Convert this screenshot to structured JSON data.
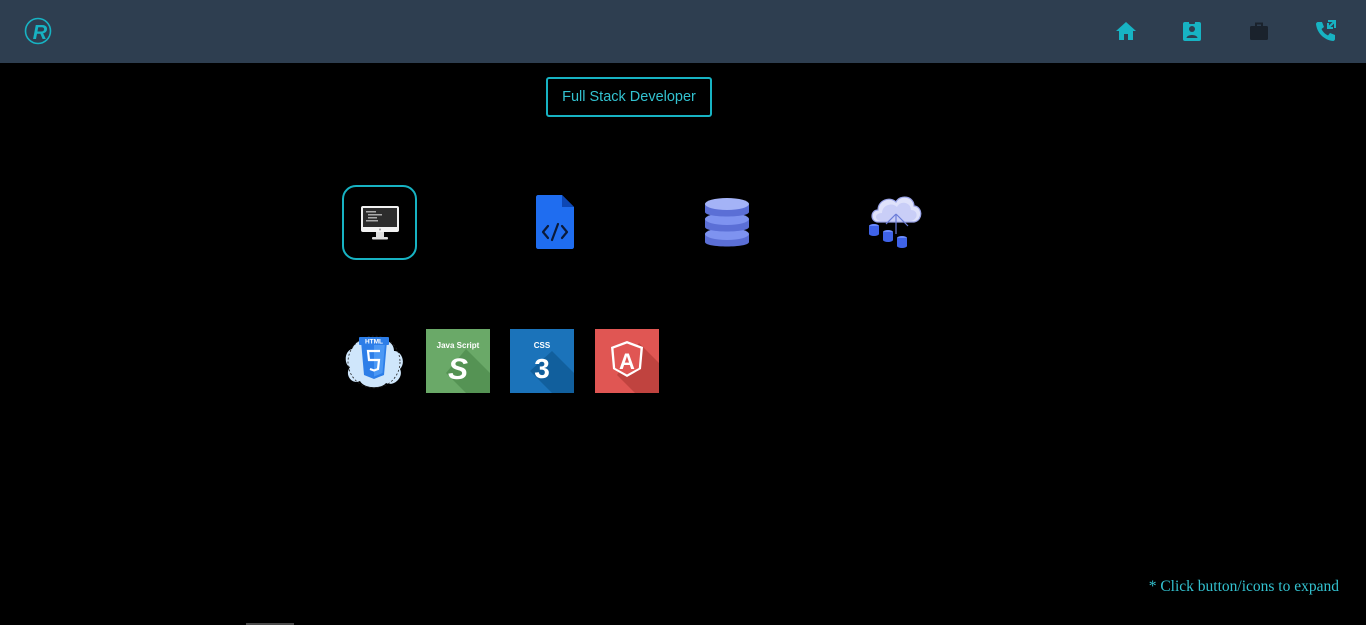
{
  "header": {
    "logo_icon": "r-logo-icon",
    "nav_icons": [
      "home-icon",
      "contact-card-icon",
      "briefcase-icon",
      "phone-call-icon"
    ]
  },
  "main": {
    "role_button_label": "Full Stack Developer",
    "categories": [
      {
        "icon": "monitor-code-icon",
        "selected": true
      },
      {
        "icon": "code-file-icon",
        "selected": false
      },
      {
        "icon": "database-icon",
        "selected": false
      },
      {
        "icon": "cloud-database-icon",
        "selected": false
      }
    ],
    "technologies": [
      {
        "icon": "html5-icon",
        "label": "HTML"
      },
      {
        "icon": "javascript-icon",
        "label": "Java Script",
        "glyph": "S",
        "color": "#6aa968"
      },
      {
        "icon": "css3-icon",
        "label": "CSS",
        "glyph": "3",
        "color": "#1b73ba"
      },
      {
        "icon": "angular-icon",
        "label": "",
        "glyph": "A",
        "color": "#e05653"
      }
    ]
  },
  "footer": {
    "hint_text": "* Click button/icons to expand"
  },
  "colors": {
    "navbar": "#2e3e50",
    "accent": "#17b3c3",
    "background": "#000000"
  }
}
